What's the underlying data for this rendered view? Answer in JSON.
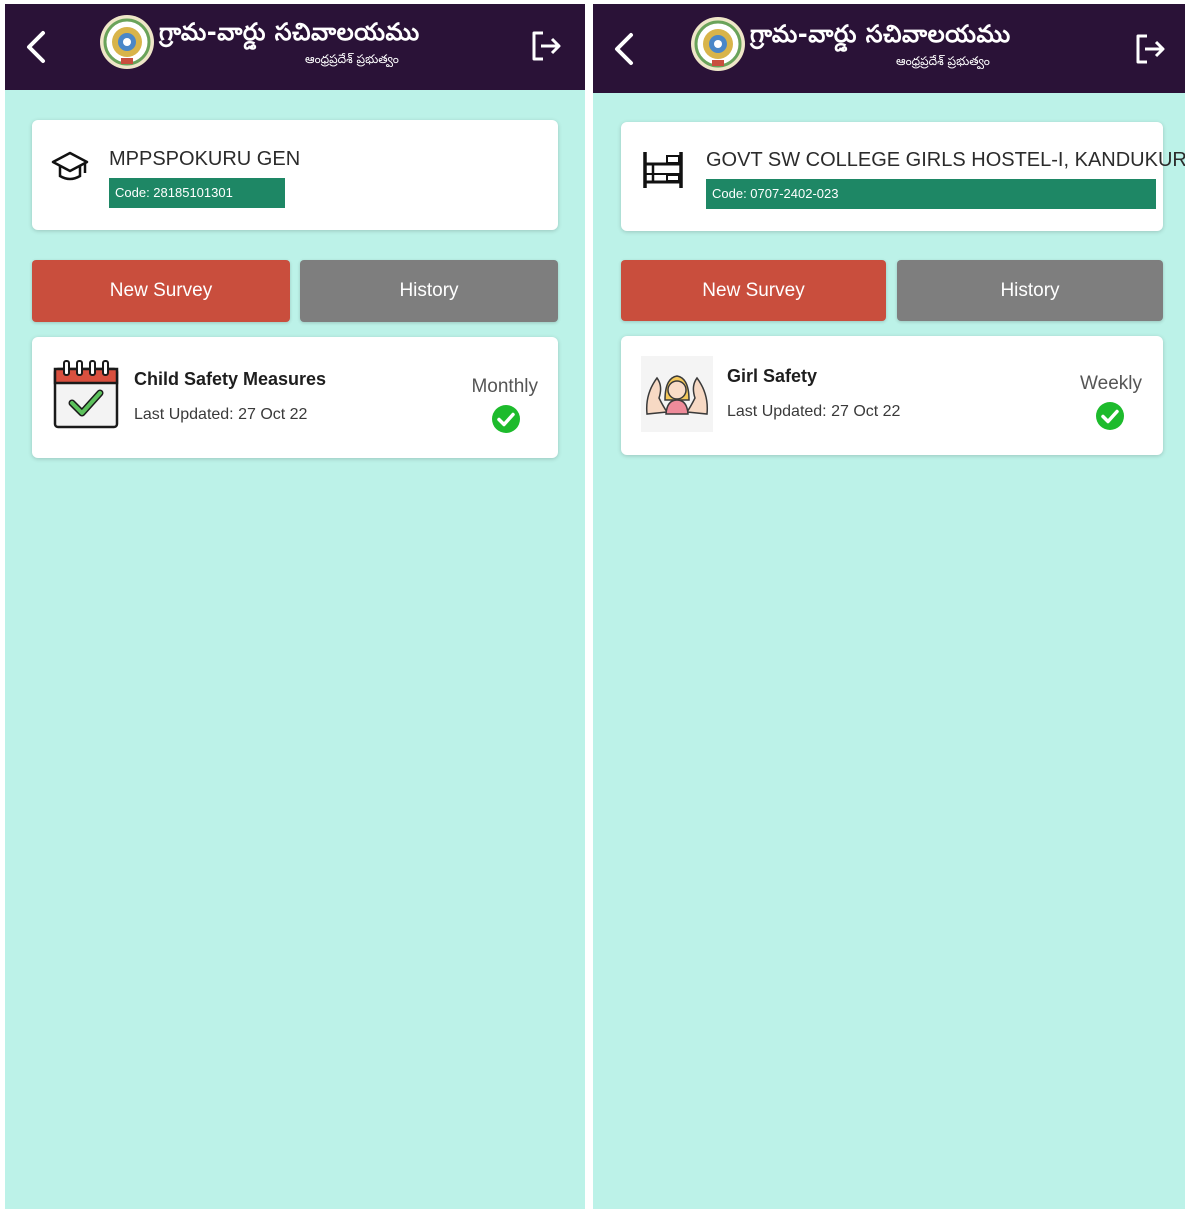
{
  "brand": {
    "title": "గ్రామ-వార్డు సచివాలయము",
    "subtitle": "ఆంధ్రప్రదేశ్ ప్రభుత్వం",
    "header_color": "#2a1237",
    "accent_color": "#1e8765"
  },
  "screens": [
    {
      "institution": {
        "name": "MPPSPOKURU GEN",
        "code": "Code: 28185101301",
        "icon": "graduation-cap-icon"
      },
      "buttons": {
        "new_survey": "New Survey",
        "history": "History"
      },
      "survey": {
        "title": "Child Safety Measures",
        "last_updated": "Last Updated: 27 Oct 22",
        "frequency": "Monthly",
        "icon": "calendar-check-icon",
        "status": "completed"
      }
    },
    {
      "institution": {
        "name": "GOVT SW COLLEGE GIRLS HOSTEL-I, KANDUKUR",
        "code": "Code: 0707-2402-023",
        "icon": "bunk-bed-icon"
      },
      "buttons": {
        "new_survey": "New Survey",
        "history": "History"
      },
      "survey": {
        "title": "Girl Safety",
        "last_updated": "Last Updated: 27 Oct 22",
        "frequency": "Weekly",
        "icon": "protected-girl-icon",
        "status": "completed"
      }
    }
  ]
}
